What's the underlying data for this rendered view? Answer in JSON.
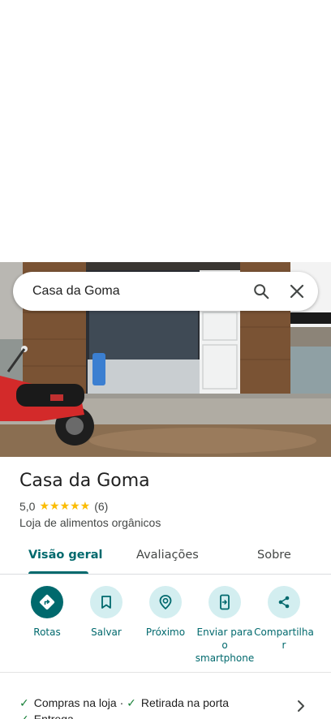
{
  "search": {
    "query": "Casa da Goma"
  },
  "place": {
    "name": "Casa da Goma",
    "rating": "5,0",
    "stars": "★★★★★",
    "review_count": "(6)",
    "category": "Loja de alimentos orgânicos"
  },
  "tabs": [
    {
      "label": "Visão geral",
      "active": true
    },
    {
      "label": "Avaliações",
      "active": false
    },
    {
      "label": "Sobre",
      "active": false
    }
  ],
  "actions": [
    {
      "label": "Rotas",
      "icon": "directions-icon"
    },
    {
      "label": "Salvar",
      "icon": "bookmark-icon"
    },
    {
      "label": "Próximo",
      "icon": "nearby-icon"
    },
    {
      "label": "Enviar para o smartphone",
      "icon": "send-to-phone-icon"
    },
    {
      "label": "Compartilhar",
      "icon": "share-icon"
    }
  ],
  "services": [
    {
      "label": "Compras na loja"
    },
    {
      "label": "Retirada na porta"
    },
    {
      "label": "Entrega"
    }
  ],
  "colors": {
    "accent": "#00696d",
    "accent_light": "#d3eef0",
    "star": "#fbbc04",
    "check": "#188038"
  }
}
